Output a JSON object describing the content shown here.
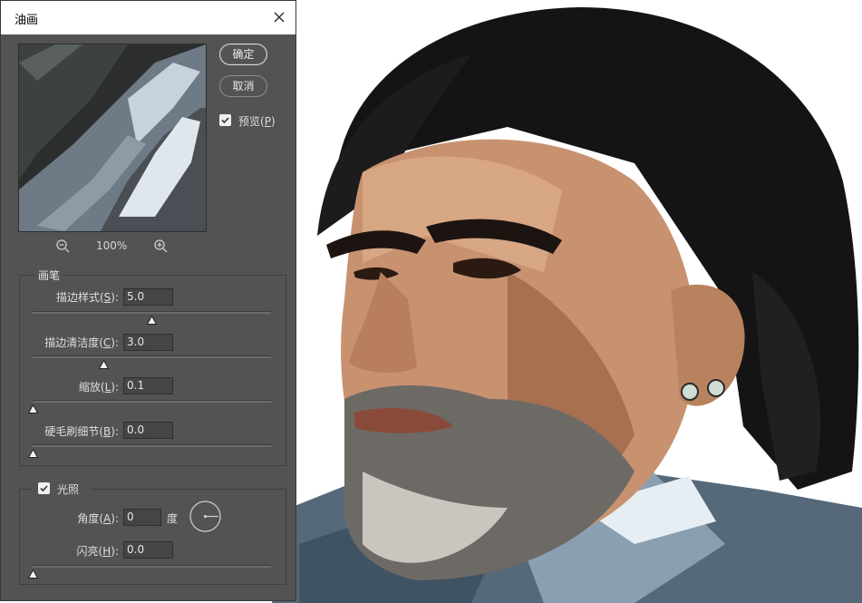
{
  "dialog": {
    "title": "油画",
    "ok_label": "确定",
    "cancel_label": "取消",
    "preview_label": "预览(",
    "preview_key": "P",
    "preview_suffix": ")",
    "preview_checked": true,
    "zoom_level": "100%"
  },
  "brush": {
    "group_title": "画笔",
    "fields": [
      {
        "label": "描边样式(",
        "key": "S",
        "suffix": "):",
        "value": "5.0",
        "level": 0.5
      },
      {
        "label": "描边清洁度(",
        "key": "C",
        "suffix": "):",
        "value": "3.0",
        "level": 0.3
      },
      {
        "label": "缩放(",
        "key": "L",
        "suffix": "):",
        "value": "0.1",
        "level": 0.0
      },
      {
        "label": "硬毛刷细节(",
        "key": "B",
        "suffix": "):",
        "value": "0.0",
        "level": 0.0
      }
    ]
  },
  "lighting": {
    "group_title": "光照",
    "checked": true,
    "angle_label": "角度(",
    "angle_key": "A",
    "angle_suffix": "):",
    "angle_value": "0",
    "angle_unit": "度",
    "shine_label": "闪亮(",
    "shine_key": "H",
    "shine_suffix": "):",
    "shine_value": "0.0",
    "shine_level": 0.0
  },
  "colors": {
    "dialog_bg": "#535353",
    "titlebar_bg": "#ffffff"
  }
}
